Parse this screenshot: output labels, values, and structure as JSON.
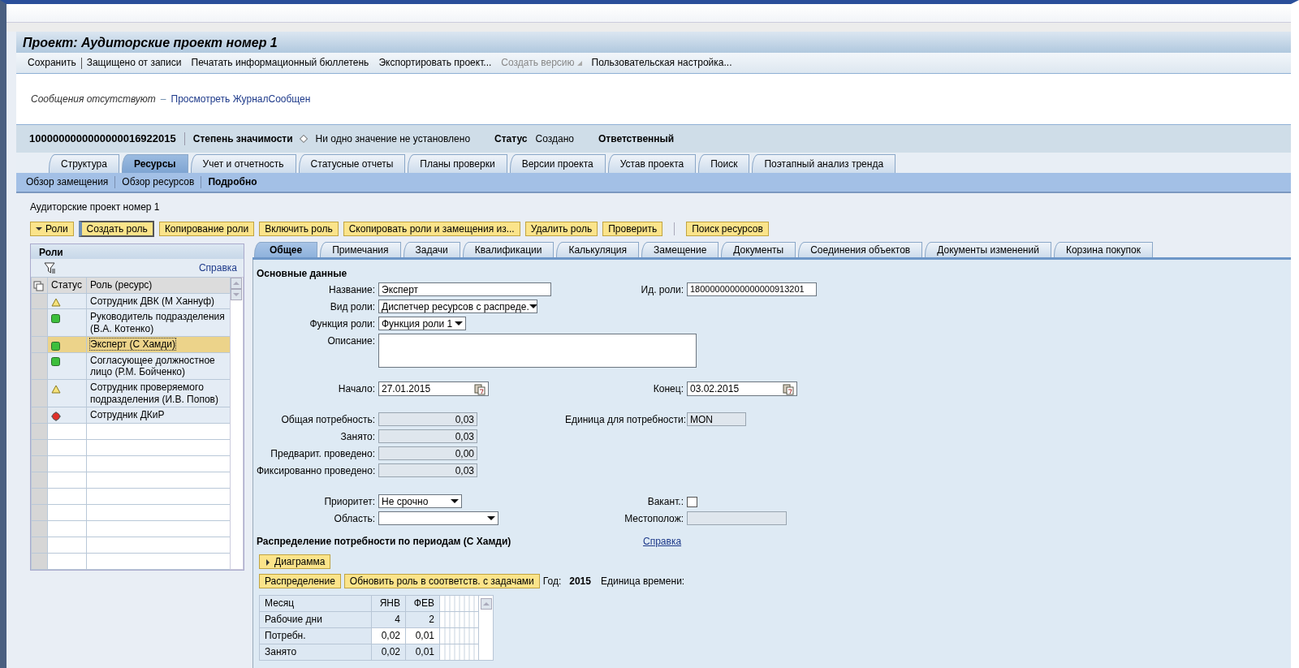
{
  "window": {
    "title": "Проект: Аудиторские проект номер 1"
  },
  "toolbar": [
    {
      "label": "Сохранить",
      "disabled": false,
      "menu": false
    },
    {
      "label": "Защищено от записи",
      "disabled": false,
      "menu": false
    },
    {
      "label": "Печатать информационный бюллетень",
      "disabled": false,
      "menu": false
    },
    {
      "label": "Экспортировать проект...",
      "disabled": false,
      "menu": false
    },
    {
      "label": "Создать версию",
      "disabled": true,
      "menu": true
    },
    {
      "label": "Пользовательская настройка...",
      "disabled": false,
      "menu": false
    }
  ],
  "messages": {
    "text": "Сообщения отсутствуют",
    "separator": "–",
    "link": "Просмотреть ЖурналСообщен"
  },
  "header": {
    "project_id": "1000000000000000016922015",
    "fields": [
      {
        "label": "Степень значимости",
        "value": "Ни одно значение не установлено",
        "kind": "diamond"
      },
      {
        "label": "Статус",
        "value": "Создано",
        "kind": "plain"
      },
      {
        "label": "Ответственный",
        "kind": "plain"
      }
    ]
  },
  "tabs": [
    {
      "label": "Структура",
      "selected": false
    },
    {
      "label": "Ресурсы",
      "selected": true
    },
    {
      "label": "Учет и отчетность",
      "selected": false
    },
    {
      "label": "Статусные отчеты",
      "selected": false
    },
    {
      "label": "Планы проверки",
      "selected": false
    },
    {
      "label": "Версии проекта",
      "selected": false
    },
    {
      "label": "Устав проекта",
      "selected": false
    },
    {
      "label": "Поиск",
      "selected": false
    },
    {
      "label": "Поэтапный анализ тренда",
      "selected": false
    }
  ],
  "subtabs": [
    {
      "label": "Обзор замещения",
      "selected": false
    },
    {
      "label": "Обзор ресурсов",
      "selected": false
    },
    {
      "label": "Подробно",
      "selected": true
    }
  ],
  "project_name": "Аудиторские проект номер 1",
  "actions": [
    {
      "label": "Роли",
      "kind": "menu"
    },
    {
      "label": "Создать роль",
      "kind": "focused"
    },
    {
      "label": "Копирование роли",
      "kind": "button"
    },
    {
      "label": "Включить роль",
      "kind": "button"
    },
    {
      "label": "Скопировать роли и замещения из...",
      "kind": "button"
    },
    {
      "label": "Удалить роль",
      "kind": "button"
    },
    {
      "label": "Проверить",
      "kind": "button"
    },
    {
      "label": "Поиск ресурсов",
      "kind": "separated"
    }
  ],
  "roles_panel": {
    "title": "Роли",
    "help": "Справка",
    "columns": [
      "Статус",
      "Роль (ресурс)"
    ],
    "rows": [
      {
        "kind": "warning",
        "role": "Сотрудник ДВК (М Ханнуф)",
        "selected": false
      },
      {
        "kind": "ok",
        "role": "Руководитель подразделения (В.А. Котенко)",
        "selected": false
      },
      {
        "kind": "ok",
        "role": "Эксперт (С Хамди)",
        "selected": true
      },
      {
        "kind": "ok",
        "role": "Согласующее должностное лицо (Р.М. Бойченко)",
        "selected": false
      },
      {
        "kind": "warning",
        "role": "Сотрудник проверяемого подразделения (И.В. Попов)",
        "selected": false
      },
      {
        "kind": "error",
        "role": "Сотрудник ДКиР",
        "selected": false
      }
    ]
  },
  "detail_tabs": [
    {
      "label": "Общее",
      "selected": true
    },
    {
      "label": "Примечания",
      "selected": false
    },
    {
      "label": "Задачи",
      "selected": false
    },
    {
      "label": "Квалификации",
      "selected": false
    },
    {
      "label": "Калькуляция",
      "selected": false
    },
    {
      "label": "Замещение",
      "selected": false
    },
    {
      "label": "Документы",
      "selected": false
    },
    {
      "label": "Соединения объектов",
      "selected": false
    },
    {
      "label": "Документы изменений",
      "selected": false
    },
    {
      "label": "Корзина покупок",
      "selected": false
    }
  ],
  "form": {
    "section": "Основные данные",
    "groups": [
      [
        {
          "left": {
            "kind": "text",
            "label": "Название:",
            "value": "Эксперт"
          },
          "right": {
            "kind": "text",
            "label": "Ид. роли:",
            "value": "18000000000000000913201"
          }
        },
        {
          "left": {
            "kind": "select",
            "label": "Вид роли:",
            "value": "Диспетчер ресурсов с распреде."
          }
        },
        {
          "left": {
            "kind": "select-small",
            "label": "Функция роли:",
            "value": "Функция роли 1"
          }
        },
        {
          "left": {
            "kind": "textarea",
            "label": "Описание:"
          }
        }
      ],
      [
        {
          "left": {
            "kind": "date",
            "label": "Начало:",
            "value": "27.01.2015"
          },
          "right": {
            "kind": "date",
            "label": "Конец:",
            "value": "03.02.2015"
          }
        }
      ],
      [
        {
          "left": {
            "kind": "number",
            "label": "Общая потребность:",
            "value": "0,03"
          },
          "right": {
            "kind": "readonly",
            "label": "Единица для потребности:",
            "value": "MON"
          }
        },
        {
          "left": {
            "kind": "number",
            "label": "Занято:",
            "value": "0,03"
          }
        },
        {
          "left": {
            "kind": "number",
            "label": "Предварит. проведено:",
            "value": "0,00"
          }
        },
        {
          "left": {
            "kind": "number",
            "label": "Фиксированно проведено:",
            "value": "0,03"
          }
        }
      ],
      [
        {
          "left": {
            "kind": "select-small",
            "label": "Приоритет:",
            "value": "Не срочно"
          },
          "right": {
            "kind": "checkbox",
            "label": "Вакант.:",
            "checked": false
          }
        },
        {
          "left": {
            "kind": "select",
            "label": "Область:"
          },
          "right": {
            "kind": "readonly-wide",
            "label": "Местополож:"
          }
        }
      ]
    ]
  },
  "distribution": {
    "title": "Распределение потребности по периодам (С Хамди)",
    "help": "Справка",
    "chart_toggle": "Диаграмма",
    "buttons": [
      "Распределение",
      "Обновить роль в соответств. с задачами"
    ],
    "year_label": "Год:",
    "year": "2015",
    "unit_label": "Единица времени:",
    "table": {
      "columns": [
        "Месяц",
        "ЯНВ",
        "ФЕВ"
      ],
      "rows": [
        {
          "cells": [
            "Рабочие дни",
            "4",
            "2"
          ],
          "editable": false
        },
        {
          "cells": [
            "Потребн.",
            "0,02",
            "0,01"
          ],
          "editable": true
        },
        {
          "cells": [
            "Занято",
            "0,02",
            "0,01"
          ],
          "editable": false
        }
      ]
    }
  }
}
